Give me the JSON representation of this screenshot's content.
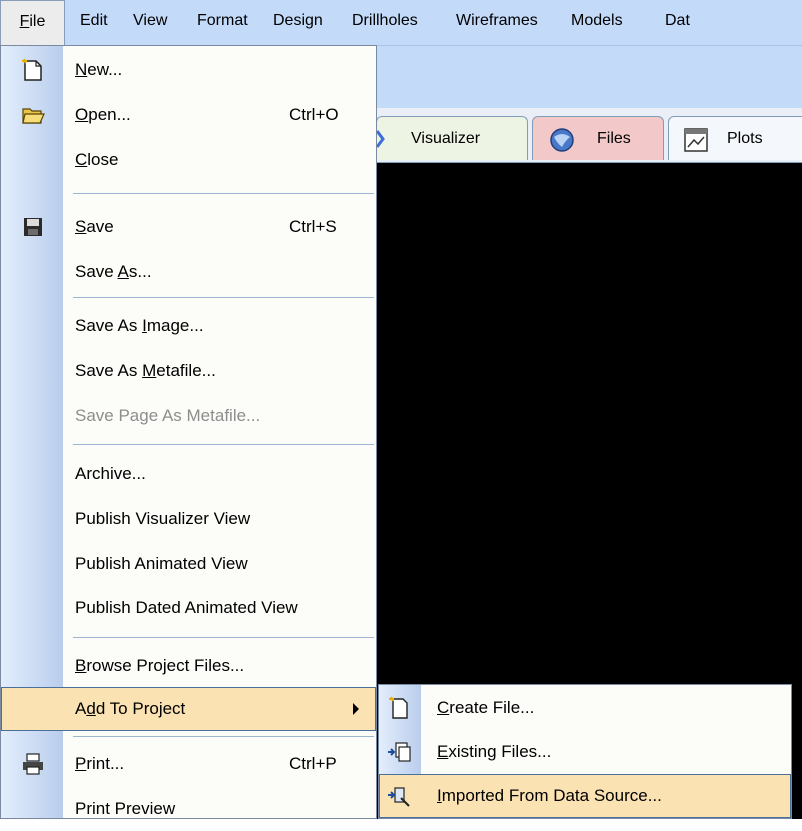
{
  "menubar": {
    "items": [
      {
        "label": "File",
        "u": "F"
      },
      {
        "label": "Edit",
        "u": "E"
      },
      {
        "label": "View",
        "u": "V"
      },
      {
        "label": "Format",
        "u": "o"
      },
      {
        "label": "Design",
        "u": "i"
      },
      {
        "label": "Drillholes",
        "u": "r"
      },
      {
        "label": "Wireframes",
        "u": "i"
      },
      {
        "label": "Models",
        "u": "M"
      },
      {
        "label": "Dat",
        "u": "D"
      }
    ]
  },
  "tabs": {
    "visualizer": "Visualizer",
    "files": "Files",
    "plots": "Plots"
  },
  "file_menu": {
    "new": {
      "pre": "",
      "u": "N",
      "post": "ew..."
    },
    "open": {
      "pre": "",
      "u": "O",
      "post": "pen...",
      "shortcut": "Ctrl+O"
    },
    "close": {
      "pre": "",
      "u": "C",
      "post": "lose"
    },
    "save": {
      "pre": "",
      "u": "S",
      "post": "ave",
      "shortcut": "Ctrl+S"
    },
    "save_as": {
      "pre": "Save ",
      "u": "A",
      "post": "s..."
    },
    "save_as_image": {
      "pre": "Save As ",
      "u": "I",
      "post": "mage..."
    },
    "save_as_metafile": {
      "pre": "Save As ",
      "u": "M",
      "post": "etafile..."
    },
    "save_page_as_metafile": {
      "label": "Save Page As Metafile..."
    },
    "archive": {
      "label": "Archive..."
    },
    "publish_visualizer_view": {
      "label": "Publish Visualizer View"
    },
    "publish_animated_view": {
      "label": "Publish Animated View"
    },
    "publish_dated_animated_view": {
      "label": "Publish Dated Animated View"
    },
    "browse_project_files": {
      "pre": "",
      "u": "B",
      "post": "rowse Project Files..."
    },
    "add_to_project": {
      "pre": "A",
      "u": "d",
      "post": "d To Project"
    },
    "print": {
      "pre": "",
      "u": "P",
      "post": "rint...",
      "shortcut": "Ctrl+P"
    },
    "print_preview": {
      "label": "Print Preview"
    }
  },
  "submenu": {
    "create_file": {
      "pre": "",
      "u": "C",
      "post": "reate File..."
    },
    "existing_files": {
      "pre": "",
      "u": "E",
      "post": "xisting Files..."
    },
    "imported_from_data_source": {
      "pre": "",
      "u": "I",
      "post": "mported From Data Source..."
    }
  },
  "colors": {
    "menubar": "#c3daf9",
    "highlight": "#fbe2b3",
    "viewport": "#000000"
  }
}
